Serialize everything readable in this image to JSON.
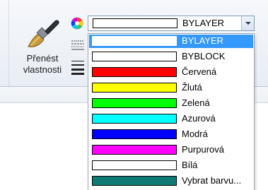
{
  "ribbon": {
    "match_properties_label": "Přenést\nvlastnosti"
  },
  "color_combo": {
    "selected_text": "BYLAYER",
    "selected_swatch": "#ffffff"
  },
  "dropdown": {
    "items": [
      {
        "label": "BYLAYER",
        "color": "#ffffff",
        "selected": true
      },
      {
        "label": "BYBLOCK",
        "color": "#ffffff",
        "selected": false
      },
      {
        "label": "Červená",
        "color": "#ff0000",
        "selected": false
      },
      {
        "label": "Žlutá",
        "color": "#ffff00",
        "selected": false
      },
      {
        "label": "Zelená",
        "color": "#00ff00",
        "selected": false
      },
      {
        "label": "Azurová",
        "color": "#00ffff",
        "selected": false
      },
      {
        "label": "Modrá",
        "color": "#0000ff",
        "selected": false
      },
      {
        "label": "Purpurová",
        "color": "#ff00ff",
        "selected": false
      },
      {
        "label": "Bílá",
        "color": "#ffffff",
        "selected": false
      },
      {
        "label": "Vybrat barvu...",
        "color": "#0f7a73",
        "selected": false
      }
    ]
  },
  "icons": {
    "brush": "match-properties-brush-icon",
    "color_wheel": "color-wheel-icon",
    "lineweight": "lineweight-icon",
    "linetype": "linetype-icon",
    "dropdown_arrow": "chevron-down-icon"
  }
}
